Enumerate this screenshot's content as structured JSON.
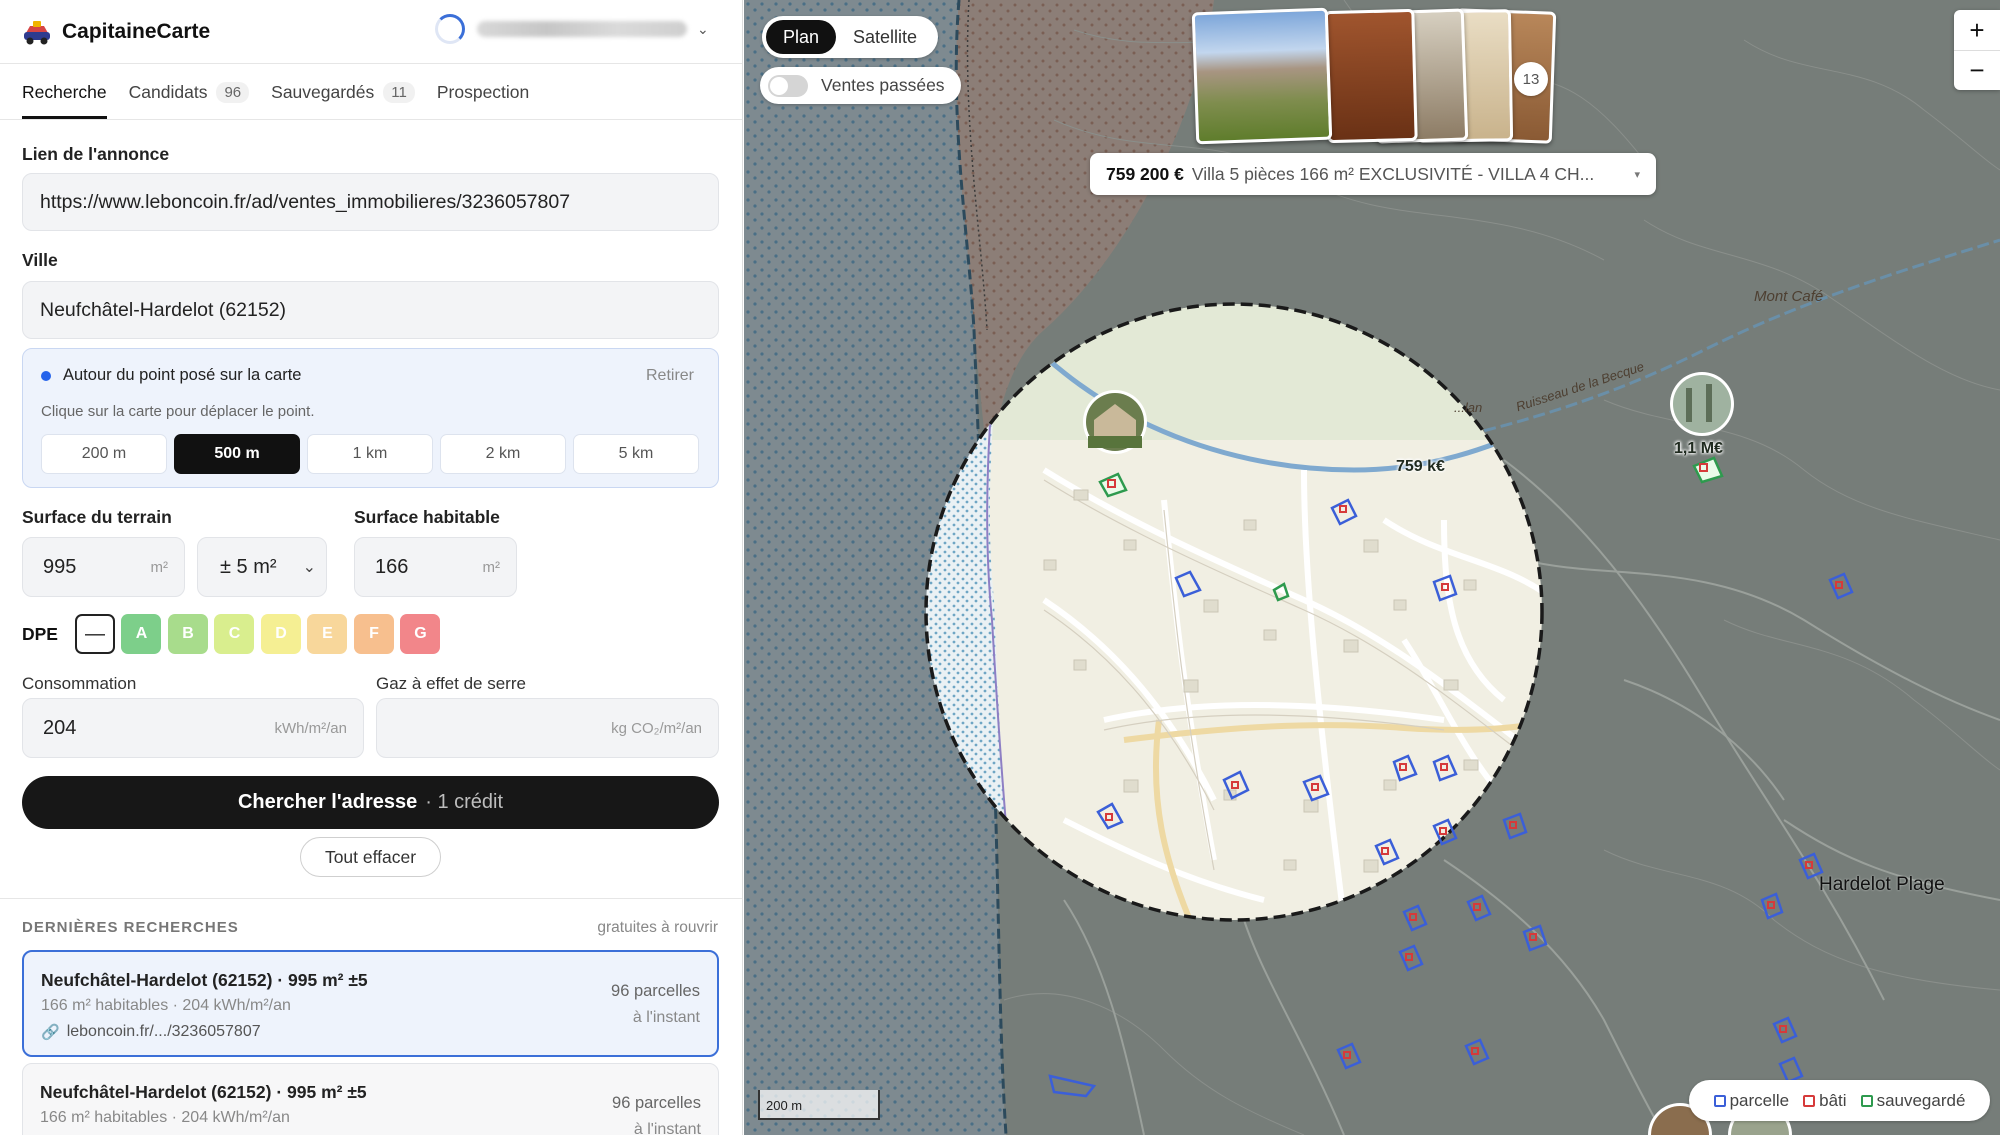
{
  "app": {
    "name": "CapitaineCarte"
  },
  "tabs": [
    {
      "label": "Recherche"
    },
    {
      "label": "Candidats",
      "count": "96"
    },
    {
      "label": "Sauvegardés",
      "count": "11"
    },
    {
      "label": "Prospection"
    }
  ],
  "form": {
    "listing_link_label": "Lien de l'annonce",
    "listing_link_value": "https://www.leboncoin.fr/ad/ventes_immobilieres/3236057807",
    "city_label": "Ville",
    "city_value": "Neufchâtel-Hardelot (62152)",
    "point": {
      "title": "Autour du point posé sur la carte",
      "remove_label": "Retirer",
      "hint": "Clique sur la carte pour déplacer le point.",
      "radii": [
        "200 m",
        "500 m",
        "1 km",
        "2 km",
        "5 km"
      ],
      "selected_radius": "500 m"
    },
    "land_area_label": "Surface du terrain",
    "land_area_value": "995",
    "land_area_unit": "m²",
    "tolerance_value": "± 5 m²",
    "living_area_label": "Surface habitable",
    "living_area_value": "166",
    "living_area_unit": "m²",
    "dpe_label": "DPE",
    "dpe_none": "—",
    "dpe_classes": [
      {
        "label": "A",
        "color": "#7dcf8a"
      },
      {
        "label": "B",
        "color": "#a8dc8c"
      },
      {
        "label": "C",
        "color": "#d9ee8e"
      },
      {
        "label": "D",
        "color": "#f5ef93"
      },
      {
        "label": "E",
        "color": "#f8d79b"
      },
      {
        "label": "F",
        "color": "#f7bf8e"
      },
      {
        "label": "G",
        "color": "#f2868a"
      }
    ],
    "consumption_label": "Consommation",
    "consumption_value": "204",
    "consumption_unit": "kWh/m²/an",
    "ghg_label": "Gaz à effet de serre",
    "ghg_value": "",
    "ghg_unit": "kg CO₂/m²/an",
    "search_button": "Chercher l'adresse",
    "search_cost": "· 1 crédit",
    "clear_button": "Tout effacer"
  },
  "recent": {
    "header": "DERNIÈRES RECHERCHES",
    "note": "gratuites à rouvrir",
    "items": [
      {
        "title": "Neufchâtel-Hardelot (62152) · 995 m² ±5",
        "subtitle": "166 m² habitables · 204 kWh/m²/an",
        "link": "leboncoin.fr/.../3236057807",
        "count": "96 parcelles",
        "when": "à l'instant"
      },
      {
        "title": "Neufchâtel-Hardelot (62152) · 995 m² ±5",
        "subtitle": "166 m² habitables · 204 kWh/m²/an",
        "count": "96 parcelles",
        "when": "à l'instant"
      }
    ]
  },
  "map": {
    "modes": [
      "Plan",
      "Satellite"
    ],
    "active_mode": "Plan",
    "past_sales_label": "Ventes passées",
    "past_sales_on": false,
    "photo_count": "13",
    "listing_price": "759 200 €",
    "listing_desc": "Villa 5 pièces 166 m² EXCLUSIVITÉ - VILLA 4 CH...",
    "pin_main_price": "759 k€",
    "pin_other_price": "1,1 M€",
    "place_hardelot": "Hardelot Plage",
    "place_cafe": "Mont Café",
    "stream_name": "Ruisseau de la Becque",
    "stream_name_short": "...lan",
    "scale_label": "200 m",
    "legend": [
      {
        "label": "parcelle",
        "color": "#3b5fd8"
      },
      {
        "label": "bâti",
        "color": "#d63a3a"
      },
      {
        "label": "sauvegardé",
        "color": "#2e9a4e"
      }
    ],
    "zoom_in": "+",
    "zoom_out": "−"
  }
}
